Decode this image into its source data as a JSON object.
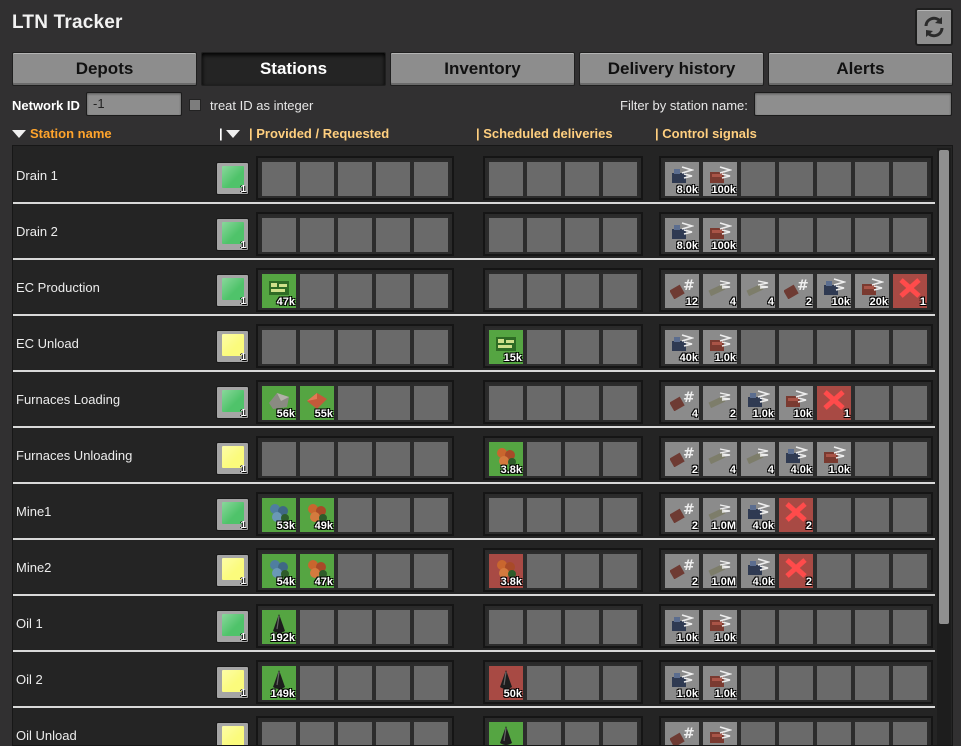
{
  "window": {
    "title": "LTN Tracker",
    "refresh_icon": "refresh-icon"
  },
  "tabs": [
    {
      "label": "Depots",
      "active": false
    },
    {
      "label": "Stations",
      "active": true
    },
    {
      "label": "Inventory",
      "active": false
    },
    {
      "label": "Delivery history",
      "active": false
    },
    {
      "label": "Alerts",
      "active": false
    }
  ],
  "filters": {
    "network_id_label": "Network ID",
    "network_id_value": "-1",
    "treat_id_label": "treat ID as integer",
    "treat_id_checked": false,
    "station_name_label": "Filter by station name:",
    "station_name_value": ""
  },
  "columns": {
    "station_name": "Station name",
    "provided_requested": "| Provided / Requested",
    "scheduled": "| Scheduled deliveries",
    "control": "| Control signals",
    "separator": "|"
  },
  "colors": {
    "green": "#4fc36a",
    "yellow": "#fbfb7c",
    "accent": "#ffa42c"
  },
  "stations": [
    {
      "name": "Drain 1",
      "status": "green",
      "status_count": "1",
      "provided": [],
      "scheduled": [],
      "control": [
        {
          "icon": "train-station-icon",
          "count": "8.0k",
          "tone": "grey"
        },
        {
          "icon": "cargo-wagon-icon",
          "count": "100k",
          "tone": "grey"
        }
      ]
    },
    {
      "name": "Drain 2",
      "status": "green",
      "status_count": "1",
      "provided": [],
      "scheduled": [],
      "control": [
        {
          "icon": "train-station-icon",
          "count": "8.0k",
          "tone": "grey"
        },
        {
          "icon": "cargo-wagon-icon",
          "count": "100k",
          "tone": "grey"
        }
      ]
    },
    {
      "name": "EC Production",
      "status": "green",
      "status_count": "1",
      "provided": [
        {
          "icon": "circuit-icon",
          "count": "47k",
          "tone": "green"
        }
      ],
      "scheduled": [],
      "control": [
        {
          "icon": "wagon-count-icon",
          "count": "12",
          "tone": "grey"
        },
        {
          "icon": "stack-icon",
          "count": "4",
          "tone": "grey"
        },
        {
          "icon": "stack-icon",
          "count": "4",
          "tone": "grey"
        },
        {
          "icon": "wagon-count-icon",
          "count": "2",
          "tone": "grey"
        },
        {
          "icon": "train-station-icon",
          "count": "10k",
          "tone": "grey"
        },
        {
          "icon": "cargo-wagon-icon",
          "count": "20k",
          "tone": "grey"
        },
        {
          "icon": "red-x-icon",
          "count": "1",
          "tone": "red"
        }
      ]
    },
    {
      "name": "EC Unload",
      "status": "yellow",
      "status_count": "1",
      "provided": [],
      "scheduled": [
        {
          "icon": "circuit-icon",
          "count": "15k",
          "tone": "green"
        }
      ],
      "control": [
        {
          "icon": "train-station-icon",
          "count": "40k",
          "tone": "grey"
        },
        {
          "icon": "cargo-wagon-icon",
          "count": "1.0k",
          "tone": "grey"
        }
      ]
    },
    {
      "name": "Furnaces Loading",
      "status": "green",
      "status_count": "1",
      "provided": [
        {
          "icon": "stone-icon",
          "count": "56k",
          "tone": "green"
        },
        {
          "icon": "copper-plate-icon",
          "count": "55k",
          "tone": "green"
        }
      ],
      "scheduled": [],
      "control": [
        {
          "icon": "wagon-count-icon",
          "count": "4",
          "tone": "grey"
        },
        {
          "icon": "stack-icon",
          "count": "2",
          "tone": "grey"
        },
        {
          "icon": "train-station-icon",
          "count": "1.0k",
          "tone": "grey"
        },
        {
          "icon": "cargo-wagon-icon",
          "count": "10k",
          "tone": "grey"
        },
        {
          "icon": "red-x-icon",
          "count": "1",
          "tone": "red"
        }
      ]
    },
    {
      "name": "Furnaces Unloading",
      "status": "yellow",
      "status_count": "1",
      "provided": [],
      "scheduled": [
        {
          "icon": "copper-ore-icon",
          "count": "3.8k",
          "tone": "green"
        }
      ],
      "control": [
        {
          "icon": "wagon-count-icon",
          "count": "2",
          "tone": "grey"
        },
        {
          "icon": "stack-icon",
          "count": "4",
          "tone": "grey"
        },
        {
          "icon": "stack-icon",
          "count": "4",
          "tone": "grey"
        },
        {
          "icon": "train-station-icon",
          "count": "4.0k",
          "tone": "grey"
        },
        {
          "icon": "cargo-wagon-icon",
          "count": "1.0k",
          "tone": "grey"
        }
      ]
    },
    {
      "name": "Mine1",
      "status": "green",
      "status_count": "1",
      "provided": [
        {
          "icon": "iron-ore-icon",
          "count": "53k",
          "tone": "green"
        },
        {
          "icon": "copper-ore-icon",
          "count": "49k",
          "tone": "green"
        }
      ],
      "scheduled": [],
      "control": [
        {
          "icon": "wagon-count-icon",
          "count": "2",
          "tone": "grey"
        },
        {
          "icon": "stack-icon",
          "count": "1.0M",
          "tone": "grey"
        },
        {
          "icon": "train-station-icon",
          "count": "4.0k",
          "tone": "grey"
        },
        {
          "icon": "red-x-icon",
          "count": "2",
          "tone": "red"
        }
      ]
    },
    {
      "name": "Mine2",
      "status": "yellow",
      "status_count": "1",
      "provided": [
        {
          "icon": "iron-ore-icon",
          "count": "54k",
          "tone": "green"
        },
        {
          "icon": "copper-ore-icon",
          "count": "47k",
          "tone": "green"
        }
      ],
      "scheduled": [
        {
          "icon": "copper-ore-icon",
          "count": "3.8k",
          "tone": "red"
        }
      ],
      "control": [
        {
          "icon": "wagon-count-icon",
          "count": "2",
          "tone": "grey"
        },
        {
          "icon": "stack-icon",
          "count": "1.0M",
          "tone": "grey"
        },
        {
          "icon": "train-station-icon",
          "count": "4.0k",
          "tone": "grey"
        },
        {
          "icon": "red-x-icon",
          "count": "2",
          "tone": "red"
        }
      ]
    },
    {
      "name": "Oil 1",
      "status": "green",
      "status_count": "1",
      "provided": [
        {
          "icon": "crude-oil-icon",
          "count": "192k",
          "tone": "green"
        }
      ],
      "scheduled": [],
      "control": [
        {
          "icon": "train-station-icon",
          "count": "1.0k",
          "tone": "grey"
        },
        {
          "icon": "cargo-wagon-icon",
          "count": "1.0k",
          "tone": "grey"
        }
      ]
    },
    {
      "name": "Oil 2",
      "status": "yellow",
      "status_count": "1",
      "provided": [
        {
          "icon": "crude-oil-icon",
          "count": "149k",
          "tone": "green"
        }
      ],
      "scheduled": [
        {
          "icon": "crude-oil-icon",
          "count": "50k",
          "tone": "red"
        }
      ],
      "control": [
        {
          "icon": "train-station-icon",
          "count": "1.0k",
          "tone": "grey"
        },
        {
          "icon": "cargo-wagon-icon",
          "count": "1.0k",
          "tone": "grey"
        }
      ]
    },
    {
      "name": "Oil Unload",
      "status": "yellow",
      "status_count": "1",
      "provided": [],
      "scheduled": [
        {
          "icon": "crude-oil-icon",
          "count": "",
          "tone": "green"
        }
      ],
      "control": [
        {
          "icon": "wagon-count-icon",
          "count": "",
          "tone": "grey"
        },
        {
          "icon": "cargo-wagon-icon",
          "count": "",
          "tone": "grey"
        }
      ]
    }
  ]
}
